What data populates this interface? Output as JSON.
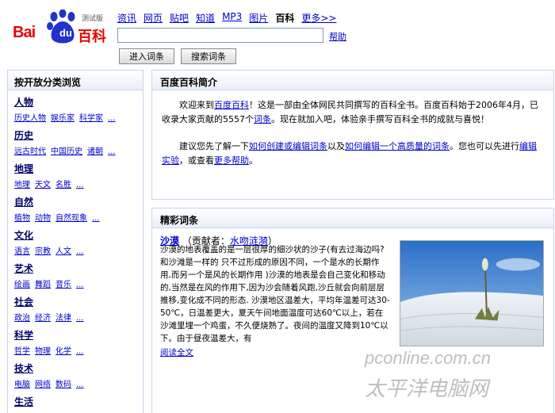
{
  "logo": {
    "bai": "Bai",
    "du": "du",
    "baike": "百科",
    "beta": "测试版"
  },
  "nav": {
    "tabs": [
      {
        "label": "资讯",
        "current": false
      },
      {
        "label": "网页",
        "current": false
      },
      {
        "label": "贴吧",
        "current": false
      },
      {
        "label": "知道",
        "current": false
      },
      {
        "label": "MP3",
        "current": false
      },
      {
        "label": "图片",
        "current": false
      },
      {
        "label": "百科",
        "current": true
      },
      {
        "label": "更多>>",
        "current": false
      }
    ]
  },
  "search": {
    "value": "",
    "help": "帮助",
    "enter_button": "进入词条",
    "search_button": "搜索词条"
  },
  "sidebar": {
    "heading": "按开放分类浏览",
    "more": "...",
    "categories": [
      {
        "title": "人物",
        "subs": [
          "历史人物",
          "娱乐家",
          "科学家"
        ]
      },
      {
        "title": "历史",
        "subs": [
          "远古时代",
          "中国历史",
          "诸朝"
        ]
      },
      {
        "title": "地理",
        "subs": [
          "地理",
          "天文",
          "名胜"
        ]
      },
      {
        "title": "自然",
        "subs": [
          "植物",
          "动物",
          "自然现象"
        ]
      },
      {
        "title": "文化",
        "subs": [
          "语言",
          "宗教",
          "人文"
        ]
      },
      {
        "title": "艺术",
        "subs": [
          "绘画",
          "舞蹈",
          "音乐"
        ]
      },
      {
        "title": "社会",
        "subs": [
          "政治",
          "经济",
          "法律"
        ]
      },
      {
        "title": "科学",
        "subs": [
          "哲学",
          "物理",
          "化学"
        ]
      },
      {
        "title": "技术",
        "subs": [
          "电脑",
          "网络",
          "数码"
        ]
      },
      {
        "title": "生活",
        "subs": []
      }
    ]
  },
  "intro": {
    "heading": "百度百科简介",
    "p1_a": "欢迎来到",
    "p1_link1": "百度百科",
    "p1_b": "！这是一部由全体网民共同撰写的百科全书。百度百科始于2006年4月，已收录大家贡献的5557个",
    "p1_link2": "词条",
    "p1_c": "。现在就加入吧，体验亲手撰写百科全书的成就与喜悦！",
    "p2_a": "建议您先了解一下",
    "p2_link1": "如何创建或编辑词条",
    "p2_b": "以及",
    "p2_link2": "如何编辑一个高质量的词条",
    "p2_c": "。您也可以先进行",
    "p2_link3": "编辑实验",
    "p2_d": "，或查看",
    "p2_link4": "更多帮助",
    "p2_e": "。"
  },
  "feature": {
    "heading": "精彩词条",
    "title": "沙漠",
    "contrib_pre": "（贡献者：",
    "contributor": "水吻涟漪",
    "contrib_post": "）",
    "text": "沙漠的地表覆盖的是一层很厚的细沙状的沙子(有去过海边吗?和沙滩是一样的 只不过形成的原因不同，一个是水的长期作用,而另一个是风的长期作用 )沙漠的地表是会自己变化和移动的,当然是在风的作用下,因为沙会随着风跑,沙丘就会向前层层推移,变化成不同的形态. 沙漠地区温差大，平均年温差可达30-50℃，日温差更大，夏天午间地面温度可达60℃以上，若在沙滩里埋一个鸡蛋，不久便烧熟了。夜间的温度又降到10℃以下。由于昼夜温差大，有",
    "more": "阅读全文"
  },
  "watermark": {
    "text1": "pconline.com.cn",
    "text2": "太平洋电脑网"
  },
  "colors": {
    "brand_red": "#e10602",
    "brand_blue": "#2233cc",
    "link": "#0000cc",
    "border": "#c4d6ec"
  }
}
